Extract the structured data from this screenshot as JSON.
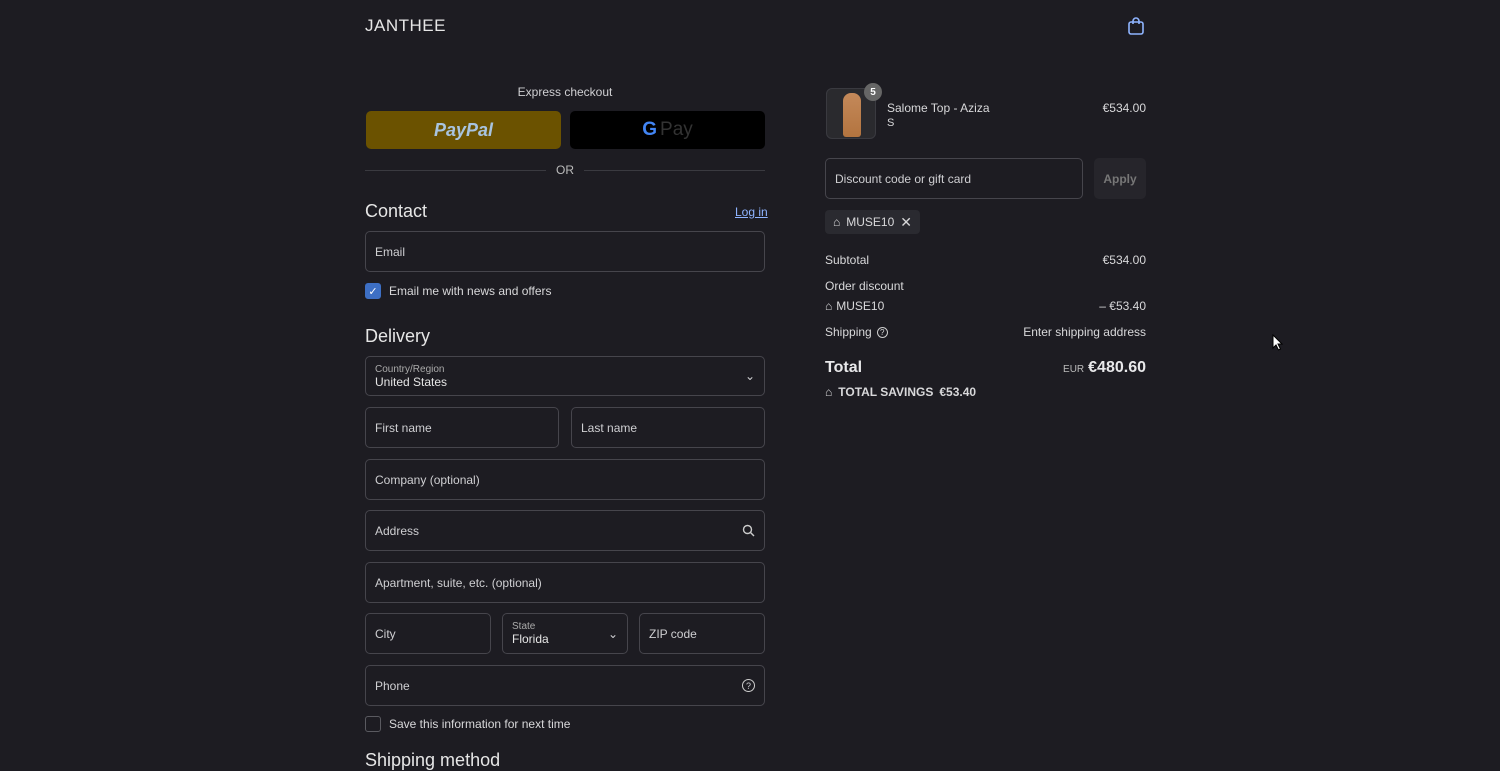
{
  "header": {
    "brand": "JANTHEE",
    "cart_icon": "shopping-bag-icon"
  },
  "express": {
    "title": "Express checkout",
    "paypal": "PayPal",
    "gpay_g": "G",
    "gpay": "Pay",
    "or": "OR"
  },
  "contact": {
    "title": "Contact",
    "login": "Log in",
    "email_placeholder": "Email",
    "newsletter": "Email me with news and offers",
    "newsletter_checked": true
  },
  "delivery": {
    "title": "Delivery",
    "country_label": "Country/Region",
    "country_value": "United States",
    "first_name": "First name",
    "last_name": "Last name",
    "company": "Company (optional)",
    "address": "Address",
    "apartment": "Apartment, suite, etc. (optional)",
    "city": "City",
    "state_label": "State",
    "state_value": "Florida",
    "zip": "ZIP code",
    "phone": "Phone",
    "save_info": "Save this information for next time",
    "save_checked": false,
    "next_section": "Shipping method"
  },
  "summary": {
    "item": {
      "name": "Salome Top - Aziza",
      "variant": "S",
      "qty": "5",
      "price": "€534.00"
    },
    "discount_placeholder": "Discount code or gift card",
    "apply": "Apply",
    "applied_code": "MUSE10",
    "subtotal_label": "Subtotal",
    "subtotal": "€534.00",
    "order_discount_label": "Order discount",
    "discount_code": "MUSE10",
    "discount_amount": "– €53.40",
    "shipping_label": "Shipping",
    "shipping_value": "Enter shipping address",
    "total_label": "Total",
    "currency": "EUR",
    "total": "€480.60",
    "savings_label": "TOTAL SAVINGS",
    "savings": "€53.40"
  }
}
